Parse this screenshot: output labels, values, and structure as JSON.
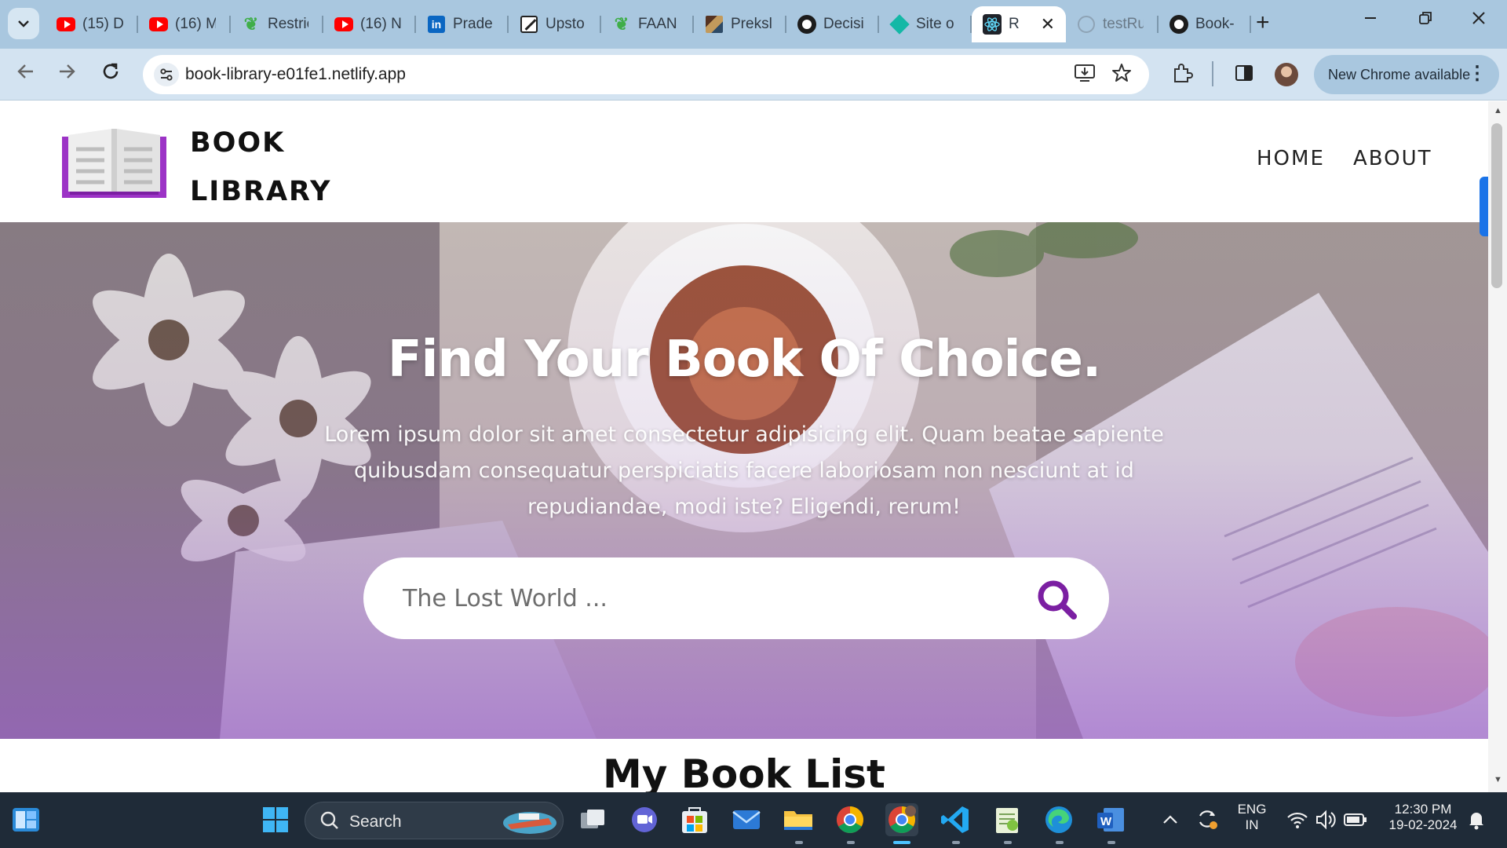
{
  "browser": {
    "tabs": [
      {
        "favicon": "youtube-icon",
        "label": "(15) D"
      },
      {
        "favicon": "youtube-icon",
        "label": "(16) M"
      },
      {
        "favicon": "leaf-icon",
        "label": "Restric"
      },
      {
        "favicon": "youtube-icon",
        "label": "(16) N"
      },
      {
        "favicon": "linkedin-icon",
        "label": "Prade"
      },
      {
        "favicon": "pen-icon",
        "label": "Upsto"
      },
      {
        "favicon": "leaf-icon",
        "label": "FAAN"
      },
      {
        "favicon": "photo-icon",
        "label": "Preksl"
      },
      {
        "favicon": "github-icon",
        "label": "Decisi"
      },
      {
        "favicon": "diamond-icon",
        "label": "Site o"
      },
      {
        "favicon": "react-icon",
        "label": "R",
        "active": true
      },
      {
        "favicon": "globe-icon",
        "label": "testRu"
      },
      {
        "favicon": "github-icon",
        "label": "Book-"
      }
    ],
    "close_tab_glyph": "✕",
    "new_tab_glyph": "+",
    "url": "book-library-e01fe1.netlify.app",
    "update_chip": "New Chrome available"
  },
  "site": {
    "brand_line1": "BOOK",
    "brand_line2": "LIBRARY",
    "nav": {
      "home": "HOME",
      "about": "ABOUT"
    },
    "hero": {
      "title": "Find Your Book Of Choice.",
      "text": "Lorem ipsum dolor sit amet consectetur adipisicing elit. Quam beatae sapiente quibusdam consequatur perspiciatis facere laboriosam non nesciunt at id repudiandae, modi iste? Eligendi, rerum!",
      "search_placeholder": "The Lost World ..."
    },
    "section_title": "My Book List",
    "colors": {
      "accent": "#7b1fa2",
      "logo": "#9c33c6"
    }
  },
  "taskbar": {
    "search_label": "Search",
    "lang_line1": "ENG",
    "lang_line2": "IN",
    "time": "12:30 PM",
    "date": "19-02-2024"
  }
}
